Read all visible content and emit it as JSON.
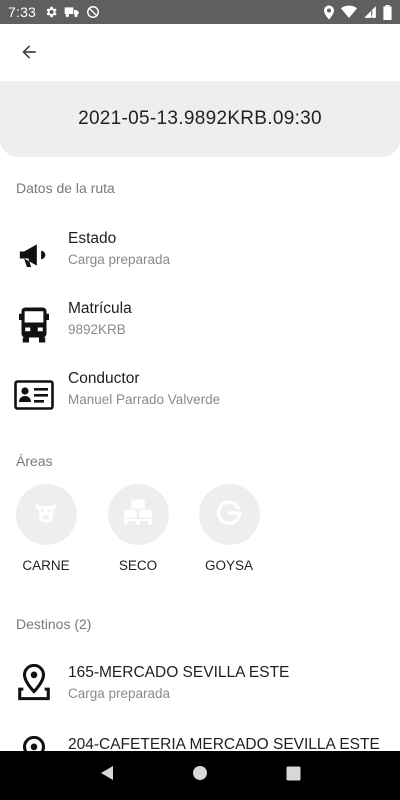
{
  "status_bar": {
    "time": "7:33",
    "icons_left": [
      "gear-icon",
      "truck-icon",
      "do-not-disturb-icon"
    ],
    "icons_right": [
      "location-icon",
      "wifi-icon",
      "signal-icon",
      "battery-icon"
    ]
  },
  "app_bar": {
    "back_icon": "arrow-back-icon"
  },
  "route": {
    "code": "2021-05-13.9892KRB.09:30"
  },
  "sections": {
    "route_data": "Datos de la ruta",
    "areas": "Áreas",
    "destinations": "Destinos (2)"
  },
  "info": {
    "estado": {
      "title": "Estado",
      "value": "Carga preparada",
      "icon": "megaphone-icon"
    },
    "matricula": {
      "title": "Matrícula",
      "value": "9892KRB",
      "icon": "truck-front-icon"
    },
    "conductor": {
      "title": "Conductor",
      "value": "Manuel Parrado Valverde",
      "icon": "id-card-icon"
    }
  },
  "areas": [
    {
      "label": "CARNE",
      "icon": "cow-icon"
    },
    {
      "label": "SECO",
      "icon": "pallet-boxes-icon"
    },
    {
      "label": "GOYSA",
      "icon": "g-logo-icon"
    }
  ],
  "destinations": [
    {
      "title": "165-MERCADO SEVILLA ESTE",
      "status": "Carga preparada",
      "icon": "map-marker-icon"
    },
    {
      "title": "204-CAFETERIA MERCADO SEVILLA ESTE",
      "status": "",
      "icon": "map-marker-icon"
    }
  ],
  "nav_bar": {
    "back": "nav-back-icon",
    "home": "nav-home-icon",
    "recents": "nav-recents-icon"
  },
  "colors": {
    "status_bar": "#5f5f5f",
    "card_bg": "#eeeeee",
    "secondary_text": "#8a8a8a",
    "nav_bar": "#000000"
  }
}
